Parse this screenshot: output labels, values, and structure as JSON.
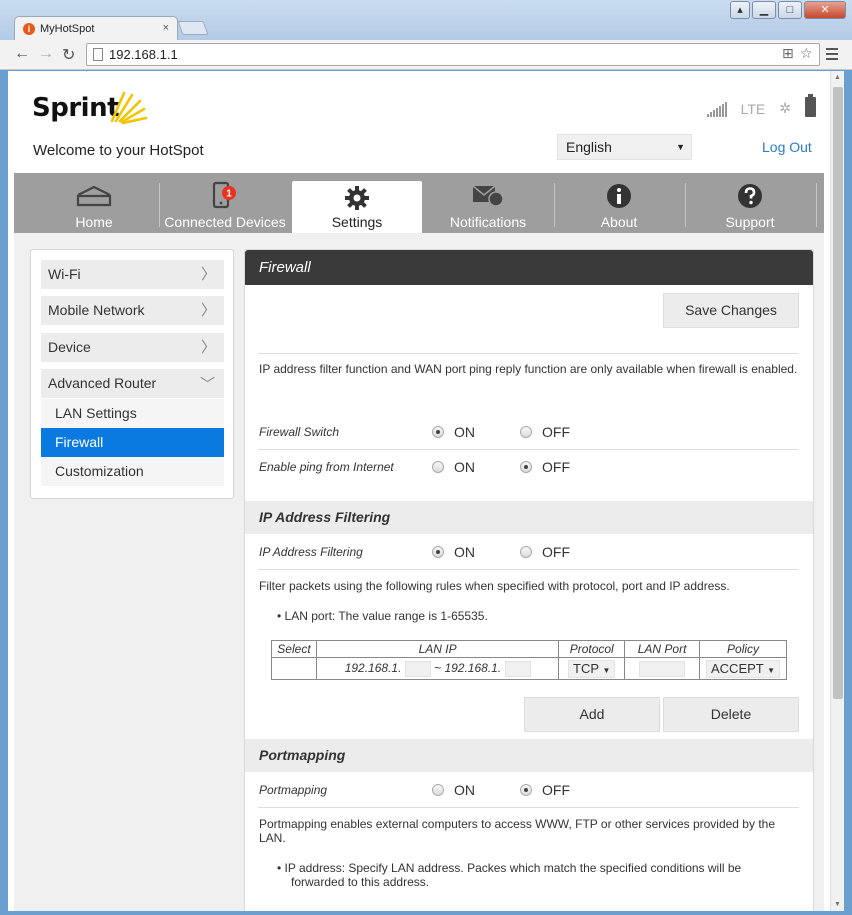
{
  "browser": {
    "tab_title": "MyHotSpot",
    "tab_icon_glyph": "i",
    "close_glyph": "×",
    "url": "192.168.1.1",
    "window_controls": {
      "minimize": "▁",
      "maximize": "□",
      "close": "✕"
    }
  },
  "header": {
    "brand": "Sprint",
    "welcome": "Welcome to your HotSpot",
    "network_type": "LTE",
    "language": "English",
    "logout": "Log Out"
  },
  "nav": {
    "tabs": [
      {
        "label": "Home",
        "icon": "home-icon"
      },
      {
        "label": "Connected Devices",
        "icon": "phone-icon",
        "badge": "1"
      },
      {
        "label": "Settings",
        "icon": "gear-icon",
        "active": true
      },
      {
        "label": "Notifications",
        "icon": "envelope-icon"
      },
      {
        "label": "About",
        "icon": "info-icon"
      },
      {
        "label": "Support",
        "icon": "question-icon"
      }
    ]
  },
  "sidebar": {
    "items": [
      {
        "label": "Wi-Fi"
      },
      {
        "label": "Mobile Network"
      },
      {
        "label": "Device"
      },
      {
        "label": "Advanced Router"
      }
    ],
    "sub_items": [
      {
        "label": "LAN Settings"
      },
      {
        "label": "Firewall",
        "active": true
      },
      {
        "label": "Customization"
      }
    ]
  },
  "firewall": {
    "title": "Firewall",
    "save_label": "Save Changes",
    "note": "IP address filter function and WAN port ping reply function are only available when firewall is enabled.",
    "switch_label": "Firewall Switch",
    "ping_label": "Enable ping from Internet",
    "on_label": "ON",
    "off_label": "OFF",
    "firewall_switch": "ON",
    "enable_ping": "OFF"
  },
  "ip_filtering": {
    "title": "IP Address Filtering",
    "row_label": "IP Address Filtering",
    "value": "ON",
    "description": "Filter packets using the following rules when specified with protocol, port and IP address.",
    "bullet": "LAN port: The value range is 1-65535.",
    "table": {
      "headers": [
        "Select",
        "LAN IP",
        "Protocol",
        "LAN Port",
        "Policy"
      ],
      "ip_prefix_start": "192.168.1.",
      "ip_separator": "~",
      "ip_prefix_end": "192.168.1.",
      "protocol": "TCP",
      "policy": "ACCEPT"
    },
    "add_label": "Add",
    "delete_label": "Delete"
  },
  "portmapping": {
    "title": "Portmapping",
    "row_label": "Portmapping",
    "value": "OFF",
    "description": "Portmapping enables external computers to access WWW, FTP or other services provided by the LAN.",
    "bullet": "IP address: Specify LAN address. Packes which match the specified conditions will be forwarded to this address."
  }
}
